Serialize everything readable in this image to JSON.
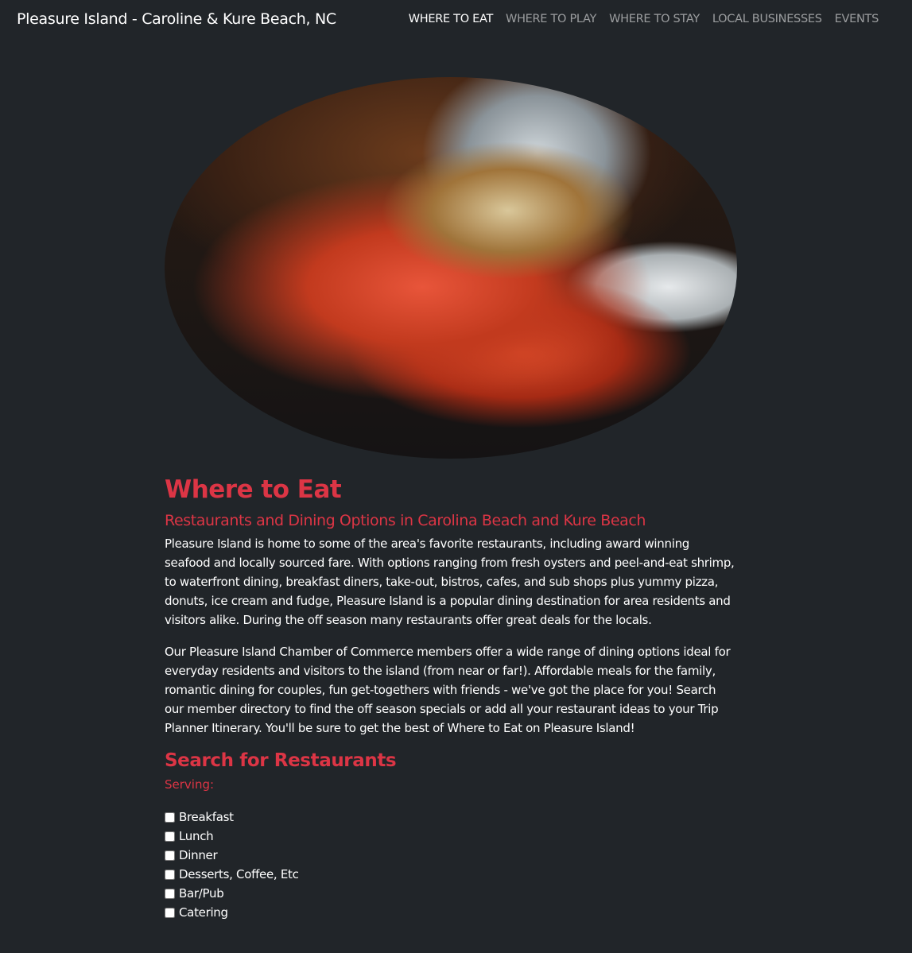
{
  "nav": {
    "brand": "Pleasure Island - Caroline & Kure Beach, NC",
    "links": [
      "WHERE TO EAT",
      "WHERE TO PLAY",
      "WHERE TO STAY",
      "LOCAL BUSINESSES",
      "EVENTS"
    ],
    "active": "WHERE TO EAT"
  },
  "hero": {
    "image": "seafood-lobster-dish-photo"
  },
  "main": {
    "title": "Where to Eat",
    "subtitle": "Restaurants and Dining Options in Carolina Beach and Kure Beach",
    "paragraphs": [
      "Pleasure Island is home to some of the area's favorite restaurants, including award winning seafood and locally sourced fare. With options ranging from fresh oysters and peel-and-eat shrimp, to waterfront dining, breakfast diners, take-out, bistros, cafes, and sub shops plus yummy pizza, donuts, ice cream and fudge, Pleasure Island is a popular dining destination for area residents and visitors alike. During the off season many restaurants offer great deals for the locals.",
      "Our Pleasure Island Chamber of Commerce members offer a wide range of dining options ideal for everyday residents and visitors to the island (from near or far!). Affordable meals for the family, romantic dining for couples, fun get-togethers with friends - we've got the place for you! Search our member directory to find the off season specials or add all your restaurant ideas to your Trip Planner Itinerary. You'll be sure to get the best of Where to Eat on Pleasure Island!"
    ],
    "search_title": "Search for Restaurants",
    "serving_label": "Serving:",
    "options": [
      "Breakfast",
      "Lunch",
      "Dinner",
      "Desserts, Coffee, Etc",
      "Bar/Pub",
      "Catering"
    ]
  },
  "colors": {
    "background": "#212529",
    "accent": "#dc3545"
  }
}
